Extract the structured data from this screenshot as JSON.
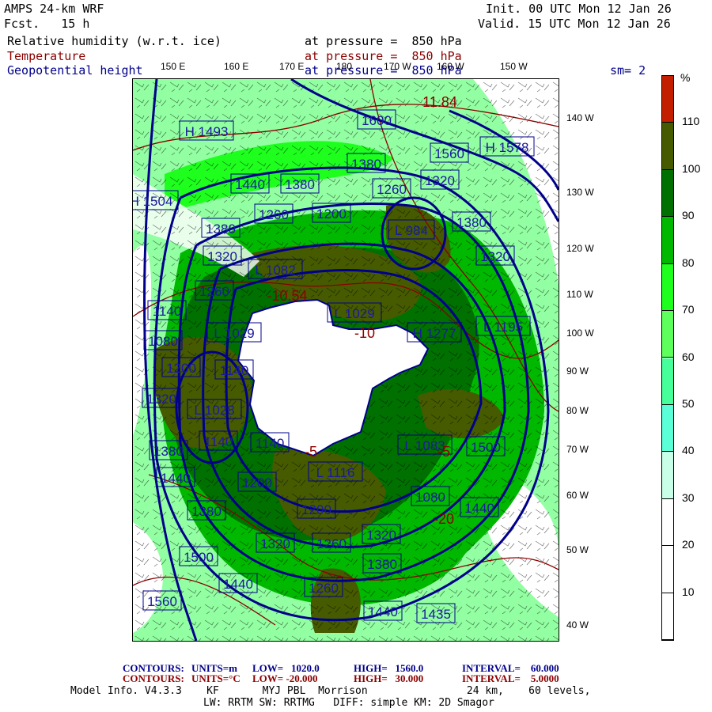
{
  "header": {
    "model": "AMPS 24-km WRF",
    "forecast": "Fcst.   15 h",
    "init": "Init. 00 UTC Mon 12 Jan 26",
    "valid": "Valid. 15 UTC Mon 12 Jan 26",
    "fields": [
      {
        "name": "Relative humidity (w.r.t. ice)",
        "level": "at pressure =  850 hPa"
      },
      {
        "name": "Temperature",
        "level": "at pressure =  850 hPa"
      },
      {
        "name": "Geopotential height",
        "level": "at pressure =  850 hPa"
      }
    ],
    "smoothing": "sm= 2"
  },
  "map": {
    "top_lon_labels": [
      "150 E",
      "160 E",
      "170 E",
      "180",
      "170 W",
      "160 W",
      "150 W"
    ],
    "right_lon_labels": [
      "140 W",
      "130 W",
      "120 W",
      "110 W",
      "100 W",
      "90 W",
      "80 W",
      "70 W",
      "60 W",
      "50 W",
      "40 W"
    ],
    "height_labels": [
      "1600",
      "H 1493",
      "1560",
      "H 1578",
      "1380",
      "1440",
      "1380",
      "1320",
      "1260",
      "H 1504",
      "1260",
      "1200",
      "1380",
      "1380",
      "L 984",
      "1320",
      "L 1082",
      "1320",
      "1260",
      "1140",
      "L 1029",
      "1080",
      "L 1029",
      "H 1277",
      "L 1195",
      "1200",
      "1140",
      "1320",
      "L 1028",
      "1380",
      "1140",
      "1140",
      "1440",
      "1200",
      "L 1116",
      "1200",
      "1380",
      "1500",
      "1320",
      "1260",
      "1320",
      "1380",
      "1080",
      "1440",
      "1560",
      "1440",
      "1260",
      "1440",
      "1435",
      "1500",
      "L 1083"
    ],
    "temperature_labels": [
      "-10.54",
      "11.84",
      "-5",
      "-10",
      "-5",
      "-20"
    ]
  },
  "colorbar": {
    "unit": "%",
    "labels": [
      "110",
      "100",
      "90",
      "80",
      "70",
      "60",
      "50",
      "40",
      "30",
      "20",
      "10"
    ],
    "colors": [
      "#c41e00",
      "#465a00",
      "#007000",
      "#00b800",
      "#1eff1e",
      "#5cff5c",
      "#46ff9a",
      "#5affd8",
      "#c8ffe8",
      "#ffffff",
      "#ffffff",
      "#ffffff"
    ]
  },
  "footer": {
    "height_contours": {
      "label": "CONTOURS:",
      "units": "UNITS=m",
      "low": "LOW=   1020.0",
      "high": "HIGH=   1560.0",
      "interval": "INTERVAL=    60.000"
    },
    "temp_contours": {
      "label": "CONTOURS:",
      "units": "UNITS=°C",
      "low": "LOW= -20.000",
      "high": "HIGH=   30.000",
      "interval": "INTERVAL=    5.0000"
    },
    "model_info": "Model Info. V4.3.3    KF       MYJ PBL  Morrison                24 km,    60 levels,",
    "physics": "LW: RRTM SW: RRTMG   DIFF: simple KM: 2D Smagor"
  }
}
